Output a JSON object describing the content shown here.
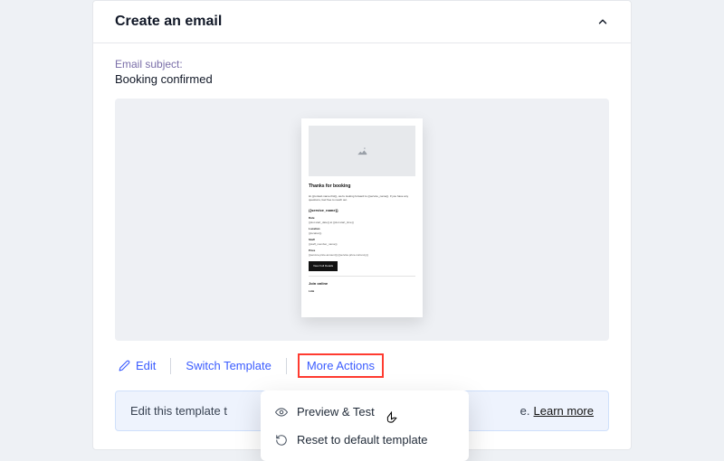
{
  "header": {
    "title": "Create an email"
  },
  "subject": {
    "label": "Email subject:",
    "value": "Booking confirmed"
  },
  "preview": {
    "heading": "Thanks for booking",
    "body": "Hi {{contact.name.first}}, we're looking forward to {{service_name}}. If you have any questions, feel free to reach out.",
    "section": "{{service_name}}",
    "fields": {
      "date_label": "Date",
      "date_value": "{{slot.start_date}} at {{slot.start_time}}",
      "location_label": "Location",
      "location_value": "{{location}}",
      "staff_label": "Staff",
      "staff_value": "{{staff_member_name}}",
      "price_label": "Price",
      "price_value": "{{service.price.amount}} {{service.price.currency}}"
    },
    "button": "View Full Details",
    "join_section": "Join online",
    "link_label": "Link"
  },
  "actions": {
    "edit": "Edit",
    "switch_template": "Switch Template",
    "more_actions": "More Actions"
  },
  "dropdown": {
    "preview_test": "Preview & Test",
    "reset": "Reset to default template"
  },
  "banner": {
    "text_prefix": "Edit this template t",
    "text_suffix": "e. ",
    "learn_more": "Learn more"
  }
}
